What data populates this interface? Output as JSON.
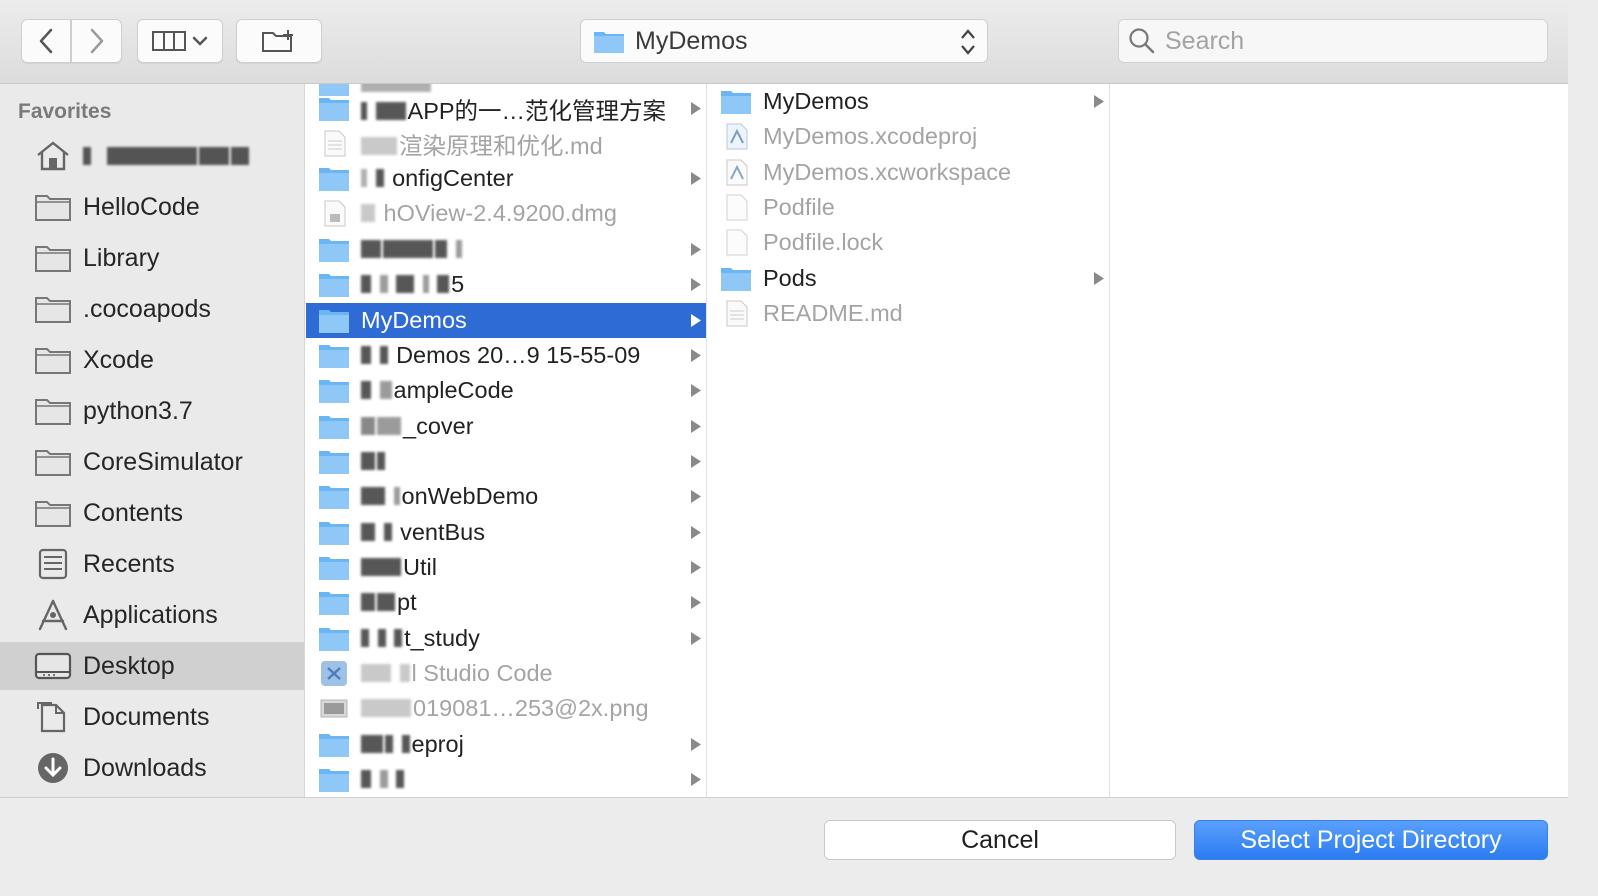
{
  "toolbar": {
    "back_icon": "chevron-left",
    "forward_icon": "chevron-right",
    "view_icon": "column-view",
    "new_folder_icon": "new-folder",
    "path_label": "MyDemos",
    "search_placeholder": "Search"
  },
  "sidebar": {
    "heading": "Favorites",
    "items": [
      {
        "label": "",
        "icon": "home-icon"
      },
      {
        "label": "HelloCode",
        "icon": "folder-icon"
      },
      {
        "label": "Library",
        "icon": "folder-icon"
      },
      {
        "label": ".cocoapods",
        "icon": "folder-icon"
      },
      {
        "label": "Xcode",
        "icon": "folder-icon"
      },
      {
        "label": "python3.7",
        "icon": "folder-icon"
      },
      {
        "label": "CoreSimulator",
        "icon": "folder-icon"
      },
      {
        "label": "Contents",
        "icon": "folder-icon"
      },
      {
        "label": "Recents",
        "icon": "recents-icon"
      },
      {
        "label": "Applications",
        "icon": "applications-icon"
      },
      {
        "label": "Desktop",
        "icon": "desktop-icon",
        "selected": true
      },
      {
        "label": "Documents",
        "icon": "documents-icon"
      },
      {
        "label": "Downloads",
        "icon": "downloads-icon"
      }
    ]
  },
  "column1": {
    "rows": [
      {
        "label": "APP的一…范化管理方案",
        "kind": "folder",
        "arrow": true
      },
      {
        "label": "渲染原理和优化.md",
        "kind": "doc",
        "dim": true
      },
      {
        "label": "onfigCenter",
        "kind": "folder",
        "arrow": true
      },
      {
        "label": "hOView-2.4.9200.dmg",
        "kind": "dmg",
        "dim": true
      },
      {
        "label": "",
        "kind": "folder",
        "arrow": true
      },
      {
        "label": "5",
        "kind": "folder",
        "arrow": true
      },
      {
        "label": "MyDemos",
        "kind": "folder",
        "arrow": true,
        "selected": true
      },
      {
        "label": "Demos 20…9 15-55-09",
        "kind": "folder",
        "arrow": true
      },
      {
        "label": "ampleCode",
        "kind": "folder",
        "arrow": true
      },
      {
        "label": "_cover",
        "kind": "folder",
        "arrow": true
      },
      {
        "label": "",
        "kind": "folder",
        "arrow": true
      },
      {
        "label": "onWebDemo",
        "kind": "folder",
        "arrow": true
      },
      {
        "label": "ventBus",
        "kind": "folder",
        "arrow": true
      },
      {
        "label": "Util",
        "kind": "folder",
        "arrow": true
      },
      {
        "label": "pt",
        "kind": "folder",
        "arrow": true
      },
      {
        "label": "t_study",
        "kind": "folder",
        "arrow": true
      },
      {
        "label": "l Studio Code",
        "kind": "app",
        "dim": true
      },
      {
        "label": "019081…253@2x.png",
        "kind": "image",
        "dim": true
      },
      {
        "label": "eproj",
        "kind": "folder",
        "arrow": true
      },
      {
        "label": "",
        "kind": "folder",
        "arrow": true
      }
    ]
  },
  "column2": {
    "rows": [
      {
        "label": "MyDemos",
        "kind": "folder",
        "arrow": true
      },
      {
        "label": "MyDemos.xcodeproj",
        "kind": "xcodeproj",
        "dim": true
      },
      {
        "label": "MyDemos.xcworkspace",
        "kind": "xcworkspace",
        "dim": true
      },
      {
        "label": "Podfile",
        "kind": "blank",
        "dim": true
      },
      {
        "label": "Podfile.lock",
        "kind": "blank",
        "dim": true
      },
      {
        "label": "Pods",
        "kind": "folder",
        "arrow": true
      },
      {
        "label": "README.md",
        "kind": "doc",
        "dim": true
      }
    ]
  },
  "buttons": {
    "cancel": "Cancel",
    "confirm": "Select Project Directory"
  },
  "colors": {
    "selection": "#2f6bd5",
    "primary_button": "#2b7cf2",
    "folder": "#6ab5f3"
  }
}
